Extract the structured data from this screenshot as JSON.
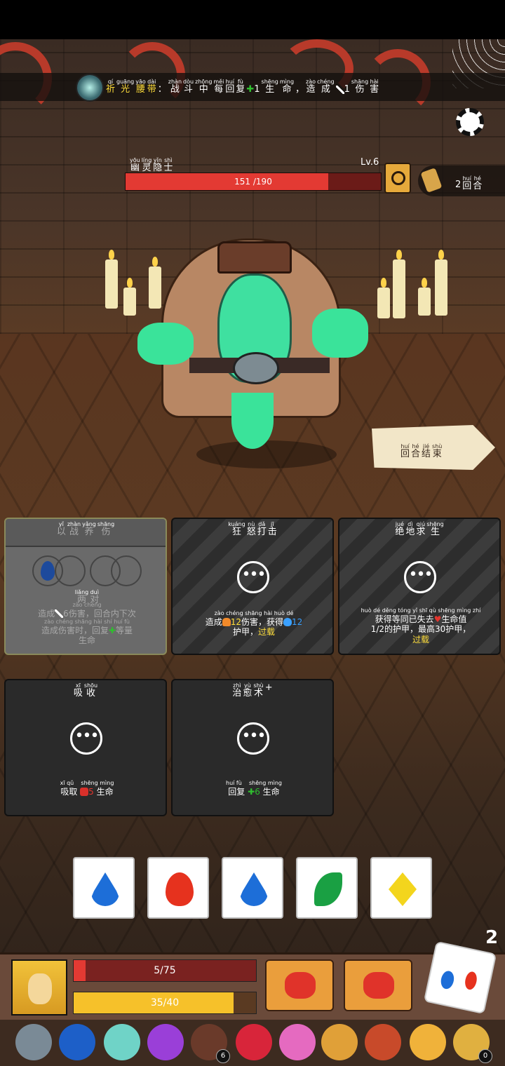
{
  "buff": {
    "name": [
      {
        "hz": "祈",
        "py": "qí"
      },
      {
        "hz": "光",
        "py": "guāng"
      },
      {
        "hz": "腰",
        "py": "yāo"
      },
      {
        "hz": "带",
        "py": "dài"
      }
    ],
    "sep": "：",
    "desc1": [
      {
        "hz": "战",
        "py": "zhàn"
      },
      {
        "hz": "斗",
        "py": "dòu"
      },
      {
        "hz": "中",
        "py": "zhōng"
      },
      {
        "hz": "每",
        "py": "měi"
      },
      {
        "hz": "回",
        "py": "huí"
      },
      {
        "hz": "复",
        "py": "fù"
      }
    ],
    "heal_value": "1",
    "desc2": [
      {
        "hz": "生",
        "py": "shēng"
      },
      {
        "hz": "命",
        "py": "mìng"
      }
    ],
    "comma": "，",
    "desc3": [
      {
        "hz": "造",
        "py": "zào"
      },
      {
        "hz": "成",
        "py": "chéng"
      }
    ],
    "damage_value": "1",
    "desc4": [
      {
        "hz": "伤",
        "py": "shāng"
      },
      {
        "hz": "害",
        "py": "hài"
      }
    ]
  },
  "enemy": {
    "name": [
      {
        "hz": "幽",
        "py": "yōu"
      },
      {
        "hz": "灵",
        "py": "líng"
      },
      {
        "hz": "隐",
        "py": "yǐn"
      },
      {
        "hz": "士",
        "py": "shì"
      }
    ],
    "hp_text": "151 /190",
    "hp": 151,
    "hp_max": 190,
    "level": "Lv.6"
  },
  "turns": {
    "text": [
      {
        "hz": "2",
        "py": ""
      },
      {
        "hz": "回",
        "py": "huí"
      },
      {
        "hz": "合",
        "py": "hé"
      }
    ]
  },
  "end_turn": {
    "label": [
      {
        "hz": "回",
        "py": "huí"
      },
      {
        "hz": "合",
        "py": "hé"
      },
      {
        "hz": "结",
        "py": "jié"
      },
      {
        "hz": "束",
        "py": "shù"
      }
    ]
  },
  "cards": [
    {
      "title": [
        {
          "hz": "以",
          "py": "yǐ"
        },
        {
          "hz": "战",
          "py": "zhàn"
        },
        {
          "hz": "养",
          "py": "yǎng"
        },
        {
          "hz": "伤",
          "py": "shāng"
        }
      ],
      "state": "used",
      "cost_label": [
        {
          "hz": "两",
          "py": "liǎng"
        },
        {
          "hz": "对",
          "py": "duì"
        }
      ],
      "desc_a": "造成",
      "desc_a_py": "zào chéng",
      "dmg": "6",
      "desc_b": "伤害，回合内下次",
      "desc_b_py": "shāng hài   huí hé nèi xià cì",
      "desc_c": "造成伤害时，回复",
      "desc_c_py": "zào chéng shāng hài shí   huí fù",
      "desc_d": "等量",
      "desc_d_py": "děng liàng",
      "desc_e": "生命",
      "desc_e_py": "shēng mìng"
    },
    {
      "title": [
        {
          "hz": "狂",
          "py": "kuáng"
        },
        {
          "hz": "怒",
          "py": "nù"
        },
        {
          "hz": "打",
          "py": "dǎ"
        },
        {
          "hz": "击",
          "py": "jī"
        }
      ],
      "state": "ready",
      "desc_a": "造成",
      "desc_a_py": "zào chéng",
      "dmg": "12",
      "desc_b": "伤害，获得",
      "desc_b_py": "shāng hài   huò dé",
      "shield": "12",
      "desc_c": "护甲，",
      "desc_c_py": "hù jiǎ",
      "desc_d": "过载",
      "desc_d_py": "guò zài"
    },
    {
      "title": [
        {
          "hz": "绝",
          "py": "jué"
        },
        {
          "hz": "地",
          "py": "dì"
        },
        {
          "hz": "求",
          "py": "qiú"
        },
        {
          "hz": "生",
          "py": "shēng"
        }
      ],
      "state": "ready",
      "desc_a": "获得等同已失去",
      "desc_a_py": "huò dé děng tóng yǐ shī qù",
      "desc_b": "生命值",
      "desc_b_py": "shēng mìng zhí",
      "desc_c": "1/2的护甲，最高30护甲，",
      "desc_c_py": "de hù jiǎ   zuì gāo   hù jiǎ",
      "desc_d": "过载",
      "desc_d_py": "guò zài"
    },
    {
      "title": [
        {
          "hz": "吸",
          "py": "xī"
        },
        {
          "hz": "收",
          "py": "shōu"
        }
      ],
      "state": "ready",
      "desc_a": "吸取",
      "desc_a_py": "xī qǔ",
      "value": "5",
      "desc_b": "生命",
      "desc_b_py": "shēng mìng"
    },
    {
      "title": [
        {
          "hz": "治",
          "py": "zhì"
        },
        {
          "hz": "愈",
          "py": "yù"
        },
        {
          "hz": "术",
          "py": "shù"
        },
        {
          "hz": "+",
          "py": ""
        }
      ],
      "state": "ready",
      "desc_a": "回复",
      "desc_a_py": "huí fù",
      "value": "6",
      "desc_b": "生命",
      "desc_b_py": "shēng mìng"
    }
  ],
  "dice": [
    {
      "symbol": "drop-icon",
      "color": "#1d6ed8"
    },
    {
      "symbol": "fire-icon",
      "color": "#e6321e"
    },
    {
      "symbol": "drop-icon",
      "color": "#1d6ed8"
    },
    {
      "symbol": "leaf-icon",
      "color": "#1aa043"
    },
    {
      "symbol": "diamond-icon",
      "color": "#f3d51d"
    }
  ],
  "rolls_left": "2",
  "player": {
    "hp_text": "5/75",
    "hp": 5,
    "hp_max": 75,
    "exp_text": "35/40",
    "exp": 35,
    "exp_max": 40
  },
  "relics": [
    {
      "name": "wolf-helmet-icon"
    },
    {
      "name": "blue-flame-icon"
    },
    {
      "name": "crystal-ball-icon"
    },
    {
      "name": "potion-icon"
    },
    {
      "name": "button-icon",
      "count": "6"
    },
    {
      "name": "ruby-icon"
    },
    {
      "name": "heart-amulet-icon"
    },
    {
      "name": "fruit-bowl-icon"
    },
    {
      "name": "meat-icon"
    },
    {
      "name": "glove-icon"
    },
    {
      "name": "money-bag-icon",
      "count": "0"
    }
  ]
}
